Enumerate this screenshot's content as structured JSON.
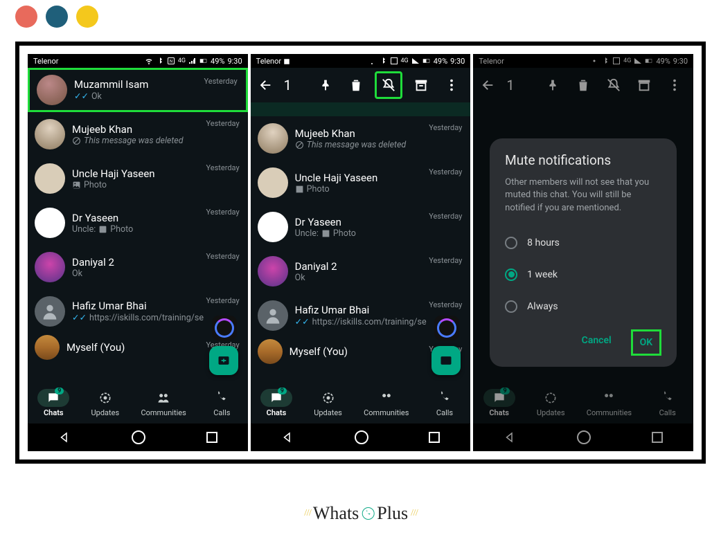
{
  "statusbar": {
    "carrier": "Telenor",
    "battery": "49%",
    "time": "9:30"
  },
  "toolbar": {
    "selected_count": "1"
  },
  "chats": [
    {
      "name": "Muzammil Isam",
      "sub": "Ok",
      "ticks": true,
      "time": "Yesterday"
    },
    {
      "name": "Mujeeb Khan",
      "sub": "This message was deleted",
      "blocked": true,
      "italic": true,
      "time": "Yesterday"
    },
    {
      "name": "Uncle Haji Yaseen",
      "sub": "Photo",
      "photo": true,
      "time": "Yesterday"
    },
    {
      "name": "Dr Yaseen",
      "sub_prefix": "Uncle:",
      "sub": "Photo",
      "photo": true,
      "time": "Yesterday"
    },
    {
      "name": "Daniyal 2",
      "sub": "Ok",
      "time": "Yesterday"
    },
    {
      "name": "Hafiz Umar Bhai",
      "sub": "https://iskills.com/training/se",
      "ticks": true,
      "time": "Yesterday"
    },
    {
      "name": "Myself (You)",
      "sub": "",
      "time": "Yesterday"
    }
  ],
  "bottomnav": {
    "chats": "Chats",
    "updates": "Updates",
    "communities": "Communities",
    "calls": "Calls",
    "badge": "9"
  },
  "dialog": {
    "title": "Mute notifications",
    "desc": "Other members will not see that you muted this chat. You will still be notified if you are mentioned.",
    "opt1": "8 hours",
    "opt2": "1 week",
    "opt3": "Always",
    "cancel": "Cancel",
    "ok": "OK"
  },
  "footer": {
    "brand1": "Whats",
    "brand2": "Plus"
  }
}
